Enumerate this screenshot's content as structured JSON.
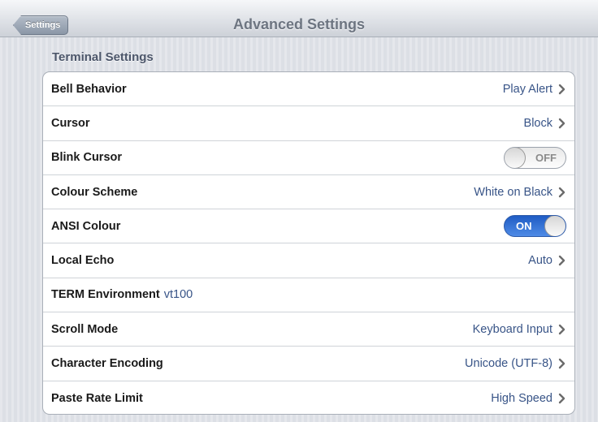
{
  "navbar": {
    "back_label": "Settings",
    "title": "Advanced Settings"
  },
  "section": {
    "header": "Terminal Settings"
  },
  "rows": [
    {
      "label": "Bell Behavior",
      "value": "Play Alert"
    },
    {
      "label": "Cursor",
      "value": "Block"
    },
    {
      "label": "Blink Cursor",
      "toggle": "OFF"
    },
    {
      "label": "Colour Scheme",
      "value": "White on Black"
    },
    {
      "label": "ANSI Colour",
      "toggle": "ON"
    },
    {
      "label": "Local Echo",
      "value": "Auto"
    },
    {
      "label": "TERM Environment",
      "inline_value": "vt100"
    },
    {
      "label": "Scroll Mode",
      "value": "Keyboard Input"
    },
    {
      "label": "Character Encoding",
      "value": "Unicode (UTF-8)"
    },
    {
      "label": "Paste Rate Limit",
      "value": "High Speed"
    }
  ],
  "colors": {
    "value_text": "#385487",
    "toggle_on": "#2f6fd6"
  },
  "icons": {
    "row_disclosure": "chevron-right-icon"
  }
}
